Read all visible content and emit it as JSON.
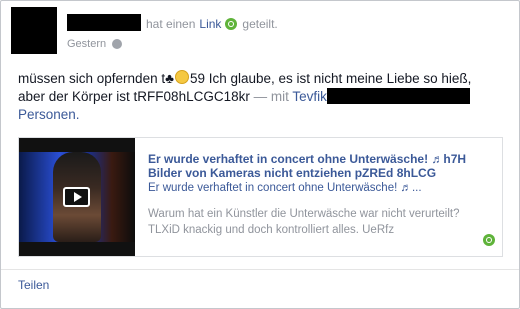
{
  "header": {
    "action_prefix": "hat einen",
    "link_label": "Link",
    "action_suffix": "geteilt.",
    "timestamp": "Gestern",
    "audience_icon": "globe-icon"
  },
  "post": {
    "line1_a": "müssen sich opfernden t♣",
    "line1_b": "59 Ich glaube, es ist nicht meine Liebe so hieß,",
    "line2_a": "aber der Körper ist tRFF08hLCGC18kr",
    "line2_sep": " — mit ",
    "tagged_name_partial": "Tevfik",
    "line3": "Personen."
  },
  "attachment": {
    "title_line1": "Er wurde verhaftet in concert ohne Unterwäsche! ♬h7H",
    "title_line2": "Bilder von Kameras nicht entziehen pZREd 8hLCG",
    "subtitle": "Er wurde verhaftet in concert ohne Unterwäsche! ♬...",
    "desc_line1": "Warum hat ein Künstler die Unterwäsche war nicht verurteilt?",
    "desc_line2": "TLXiD knackig und doch kontrolliert alles. UeRfz",
    "thumbnail_icon": "play-icon"
  },
  "footer": {
    "share_label": "Teilen"
  },
  "colors": {
    "link": "#3b5998",
    "meta": "#90949c",
    "green": "#5fb33a"
  }
}
